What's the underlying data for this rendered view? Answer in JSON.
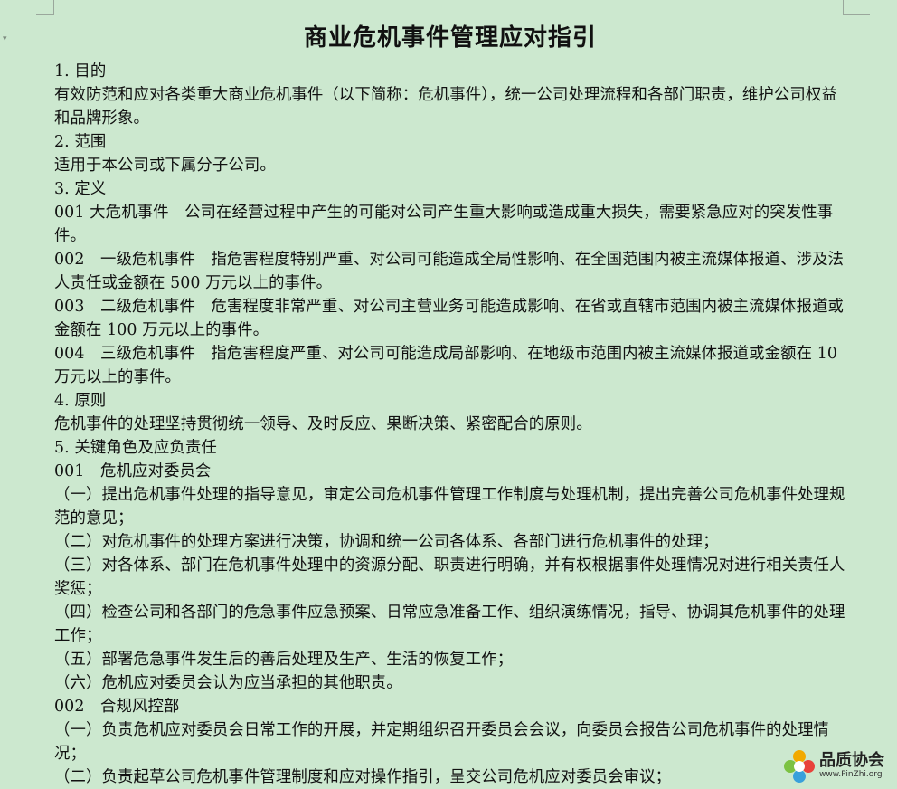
{
  "document": {
    "title": "商业危机事件管理应对指引",
    "paragraphs": [
      "1. 目的",
      "有效防范和应对各类重大商业危机事件（以下简称：危机事件），统一公司处理流程和各部门职责，维护公司权益和品牌形象。",
      "2. 范围",
      "适用于本公司或下属分子公司。",
      "3. 定义",
      "001 大危机事件　公司在经营过程中产生的可能对公司产生重大影响或造成重大损失，需要紧急应对的突发性事件。",
      "002　一级危机事件　指危害程度特别严重、对公司可能造成全局性影响、在全国范围内被主流媒体报道、涉及法人责任或金额在 500 万元以上的事件。",
      "003　二级危机事件　危害程度非常严重、对公司主营业务可能造成影响、在省或直辖市范围内被主流媒体报道或金额在 100 万元以上的事件。",
      "004　三级危机事件　指危害程度严重、对公司可能造成局部影响、在地级市范围内被主流媒体报道或金额在 10 万元以上的事件。",
      "4. 原则",
      "危机事件的处理坚持贯彻统一领导、及时反应、果断决策、紧密配合的原则。",
      "5. 关键角色及应负责任",
      "001　危机应对委员会",
      "（一）提出危机事件处理的指导意见，审定公司危机事件管理工作制度与处理机制，提出完善公司危机事件处理规范的意见；",
      "（二）对危机事件的处理方案进行决策，协调和统一公司各体系、各部门进行危机事件的处理；",
      "（三）对各体系、部门在危机事件处理中的资源分配、职责进行明确，并有权根据事件处理情况对进行相关责任人奖惩；",
      "（四）检查公司和各部门的危急事件应急预案、日常应急准备工作、组织演练情况，指导、协调其危机事件的处理工作；",
      "（五）部署危急事件发生后的善后处理及生产、生活的恢复工作；",
      "（六）危机应对委员会认为应当承担的其他职责。",
      "002　合规风控部",
      "（一）负责危机应对委员会日常工作的开展，并定期组织召开委员会会议，向委员会报告公司危机事件的处理情况；",
      "（二）负责起草公司危机事件管理制度和应对操作指引，呈交公司危机应对委员会审议；"
    ]
  },
  "watermark": {
    "brand_text": "品质协会",
    "url_text": "www.PinZhi.org"
  },
  "ruler_marker": "▾",
  "colors": {
    "background": "#cce8cf",
    "text": "#111111"
  }
}
